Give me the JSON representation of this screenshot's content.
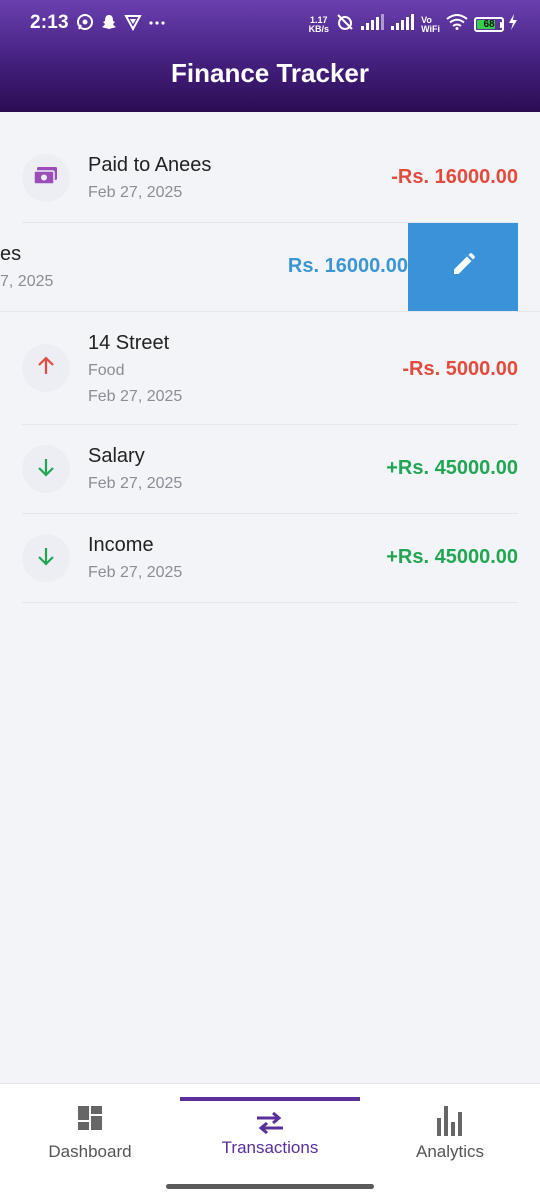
{
  "status_bar": {
    "time": "2:13",
    "net_speed_value": "1.17",
    "net_speed_unit": "KB/s",
    "vo_label": "Vo",
    "wifi_label": "WiFi",
    "battery": "68"
  },
  "app": {
    "title": "Finance Tracker"
  },
  "transactions": [
    {
      "title": "Paid to Anees",
      "date": "Feb 27, 2025",
      "amount": "-Rs. 16000.00",
      "icon": "payment-icon"
    },
    {
      "title_partial": "es",
      "date_partial": "7, 2025",
      "amount": "Rs. 16000.00",
      "action": "edit"
    },
    {
      "title": "14 Street",
      "category": "Food",
      "date": "Feb 27, 2025",
      "amount": "-Rs. 5000.00",
      "icon": "arrow-up-icon"
    },
    {
      "title": "Salary",
      "date": "Feb 27, 2025",
      "amount": "+Rs. 45000.00",
      "icon": "arrow-down-icon"
    },
    {
      "title": "Income",
      "date": "Feb 27, 2025",
      "amount": "+Rs. 45000.00",
      "icon": "arrow-down-icon"
    }
  ],
  "colors": {
    "header_top": "#6a3fb0",
    "header_bottom": "#2b0c52",
    "expense": "#e24b3d",
    "income": "#22a653",
    "swipe_action": "#3a92d8",
    "active_nav": "#5a2f9c"
  },
  "nav": {
    "items": [
      {
        "label": "Dashboard",
        "icon": "dashboard-icon"
      },
      {
        "label": "Transactions",
        "icon": "transfer-icon",
        "active": true
      },
      {
        "label": "Analytics",
        "icon": "bar-chart-icon"
      }
    ]
  }
}
